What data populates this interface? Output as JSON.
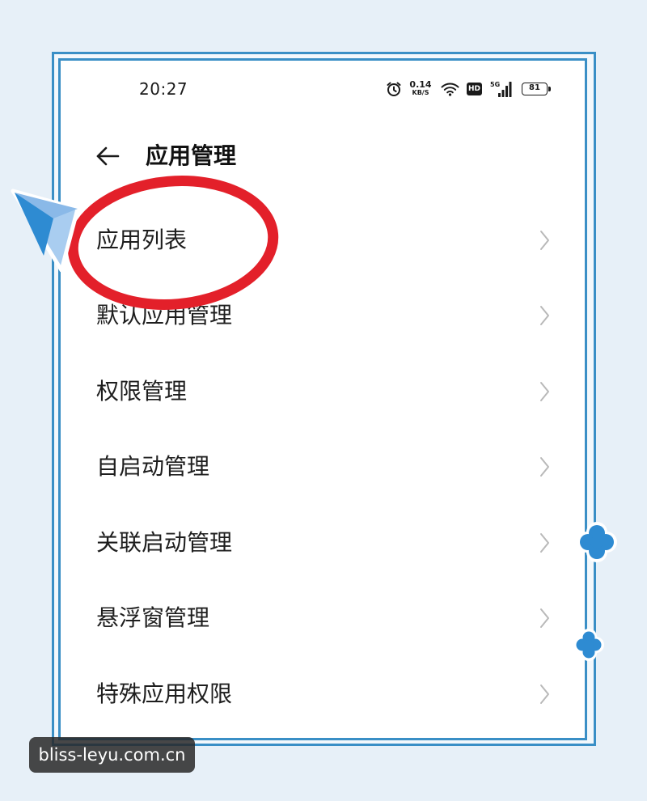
{
  "colors": {
    "page-bg": "#e7f0f8",
    "frame": "#3a8fc6",
    "annotation": "#e3202a",
    "text": "#1e1e1e",
    "chevron": "#b9b9b9",
    "deco": "#2e8bd2",
    "icon": "#1a1a1a"
  },
  "icons": {
    "alarm": "alarm-icon",
    "wifi": "wifi-icon",
    "signal": "signal-icon",
    "battery": "battery-icon",
    "back": "arrow-left-icon",
    "chevron": "chevron-right-icon",
    "paper_plane": "paper-plane-icon",
    "flower": "flower-icon"
  },
  "status_bar": {
    "time": "20:27",
    "net_speed": {
      "value": "0.14",
      "unit": "KB/S"
    },
    "hd_label": "HD",
    "network_type": "5G",
    "battery_level": "81"
  },
  "header": {
    "title": "应用管理"
  },
  "menu": {
    "items": [
      {
        "label": "应用列表",
        "circled": true
      },
      {
        "label": "默认应用管理",
        "circled": false
      },
      {
        "label": "权限管理",
        "circled": false
      },
      {
        "label": "自启动管理",
        "circled": false
      },
      {
        "label": "关联启动管理",
        "circled": false
      },
      {
        "label": "悬浮窗管理",
        "circled": false
      },
      {
        "label": "特殊应用权限",
        "circled": false
      }
    ]
  },
  "watermark": {
    "text": "bliss-leyu.com.cn"
  }
}
